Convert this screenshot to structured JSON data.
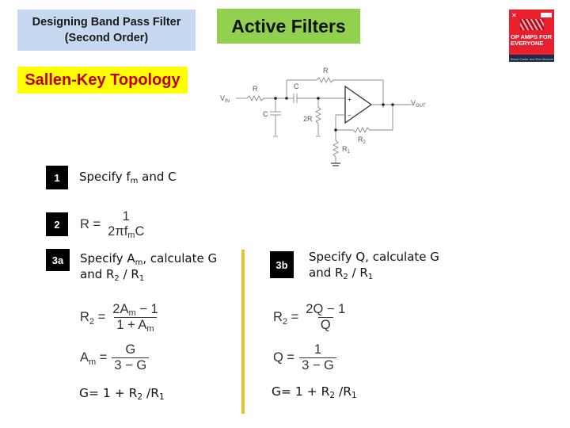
{
  "header": {
    "title_line1": "Designing Band Pass Filter",
    "title_line2": "(Second Order)",
    "section": "Active Filters",
    "topology": "Sallen-Key Topology"
  },
  "book": {
    "title_line1": "OP AMPS FOR",
    "title_line2": "EVERYONE",
    "author": "Bruce Carter and Ron Mancini",
    "colors": {
      "cover": "#e8202e",
      "band": "#1d2b4a"
    }
  },
  "schematic": {
    "labels": {
      "vin": "V",
      "vin_sub": "IN",
      "vout": "V",
      "vout_sub": "OUT",
      "r_in": "R",
      "r_fb": "R",
      "c_series": "C",
      "c_shunt": "C",
      "r_2r": "2R",
      "r2": "R",
      "r2_sub": "2",
      "r1": "R",
      "r1_sub": "1",
      "plus": "+",
      "minus": "−"
    }
  },
  "steps": [
    {
      "badge": "1",
      "text_pre": "Specify f",
      "text_sub": "m",
      "text_post": " and C"
    },
    {
      "badge": "2",
      "eq_lhs": "R =",
      "eq_num": "1",
      "eq_den_pre": "2πf",
      "eq_den_sub": "m",
      "eq_den_post": "C"
    },
    {
      "badge": "3a",
      "line1_pre": "Specify A",
      "line1_sub": "m",
      "line1_post": ", calculate G",
      "line2_pre": "and R",
      "line2_sub1": "2",
      "line2_mid": " / R",
      "line2_sub2": "1"
    },
    {
      "badge": "3b",
      "line1": "Specify Q, calculate G",
      "line2_pre": "and R",
      "line2_sub1": "2",
      "line2_mid": " / R",
      "line2_sub2": "1"
    }
  ],
  "left_equations": {
    "r2": {
      "lhs": "R",
      "lhs_sub": "2",
      "num_pre": "2A",
      "num_sub": "m",
      "num_post": " − 1",
      "den_pre": "1 + A",
      "den_sub": "m"
    },
    "am": {
      "lhs": "A",
      "lhs_sub": "m",
      "num": "G",
      "den": "3 − G"
    },
    "gain": {
      "pre": "G= 1 + R",
      "sub1": "2",
      "mid": " /R",
      "sub2": "1"
    }
  },
  "right_equations": {
    "r2": {
      "lhs": "R",
      "lhs_sub": "2",
      "num": "2Q − 1",
      "den": "Q"
    },
    "q": {
      "lhs": "Q",
      "num": "1",
      "den": "3 − G"
    },
    "gain": {
      "pre": "G= 1 + R",
      "sub1": "2",
      "mid": " /R",
      "sub2": "1"
    }
  },
  "colors": {
    "title_box": "#c6d9f1",
    "section_box": "#92d050",
    "topology_box": "#ffff00",
    "topology_text": "#c00000",
    "divider": "#e9c12c"
  }
}
